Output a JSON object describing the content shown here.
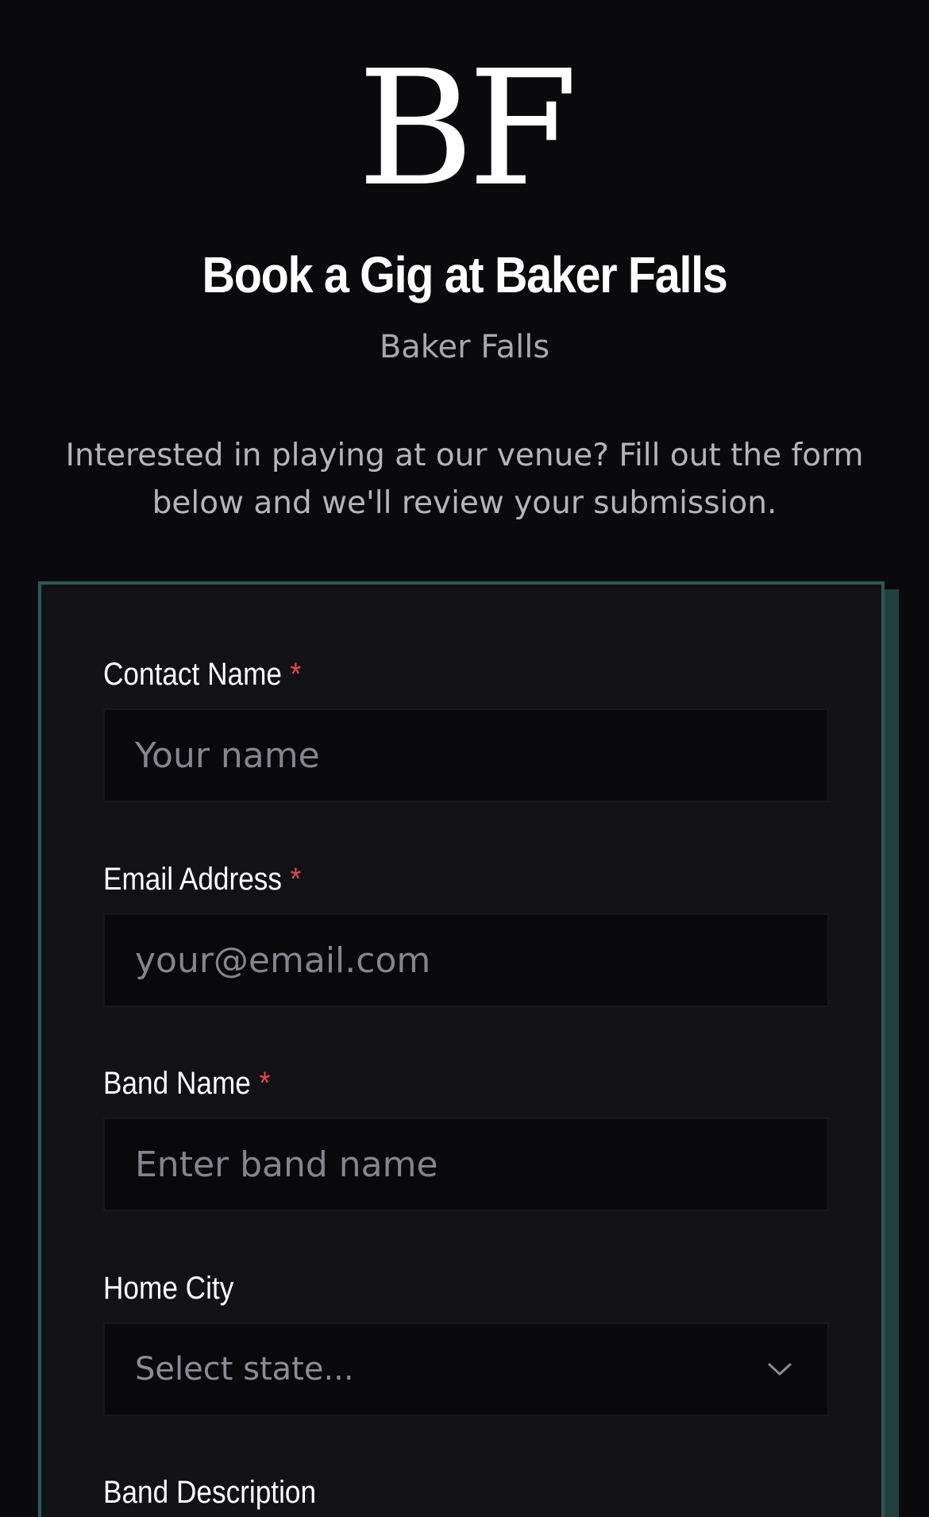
{
  "logo": {
    "text": "BF"
  },
  "header": {
    "title": "Book a Gig at Baker Falls",
    "subtitle": "Baker Falls",
    "intro": "Interested in playing at our venue? Fill out the form below and we'll review your submission."
  },
  "form": {
    "required_marker": "*",
    "contact_name": {
      "label": "Contact Name",
      "placeholder": "Your name"
    },
    "email": {
      "label": "Email Address",
      "placeholder": "your@email.com"
    },
    "band_name": {
      "label": "Band Name",
      "placeholder": "Enter band name"
    },
    "home_city": {
      "label": "Home City",
      "selected": "Select state..."
    },
    "band_description": {
      "label": "Band Description"
    }
  },
  "colors": {
    "background": "#0a0a0c",
    "card": "#111116",
    "card_border": "#2a5a52",
    "required": "#e5484d"
  },
  "icons": {
    "select_caret": "chevron-down-icon"
  }
}
